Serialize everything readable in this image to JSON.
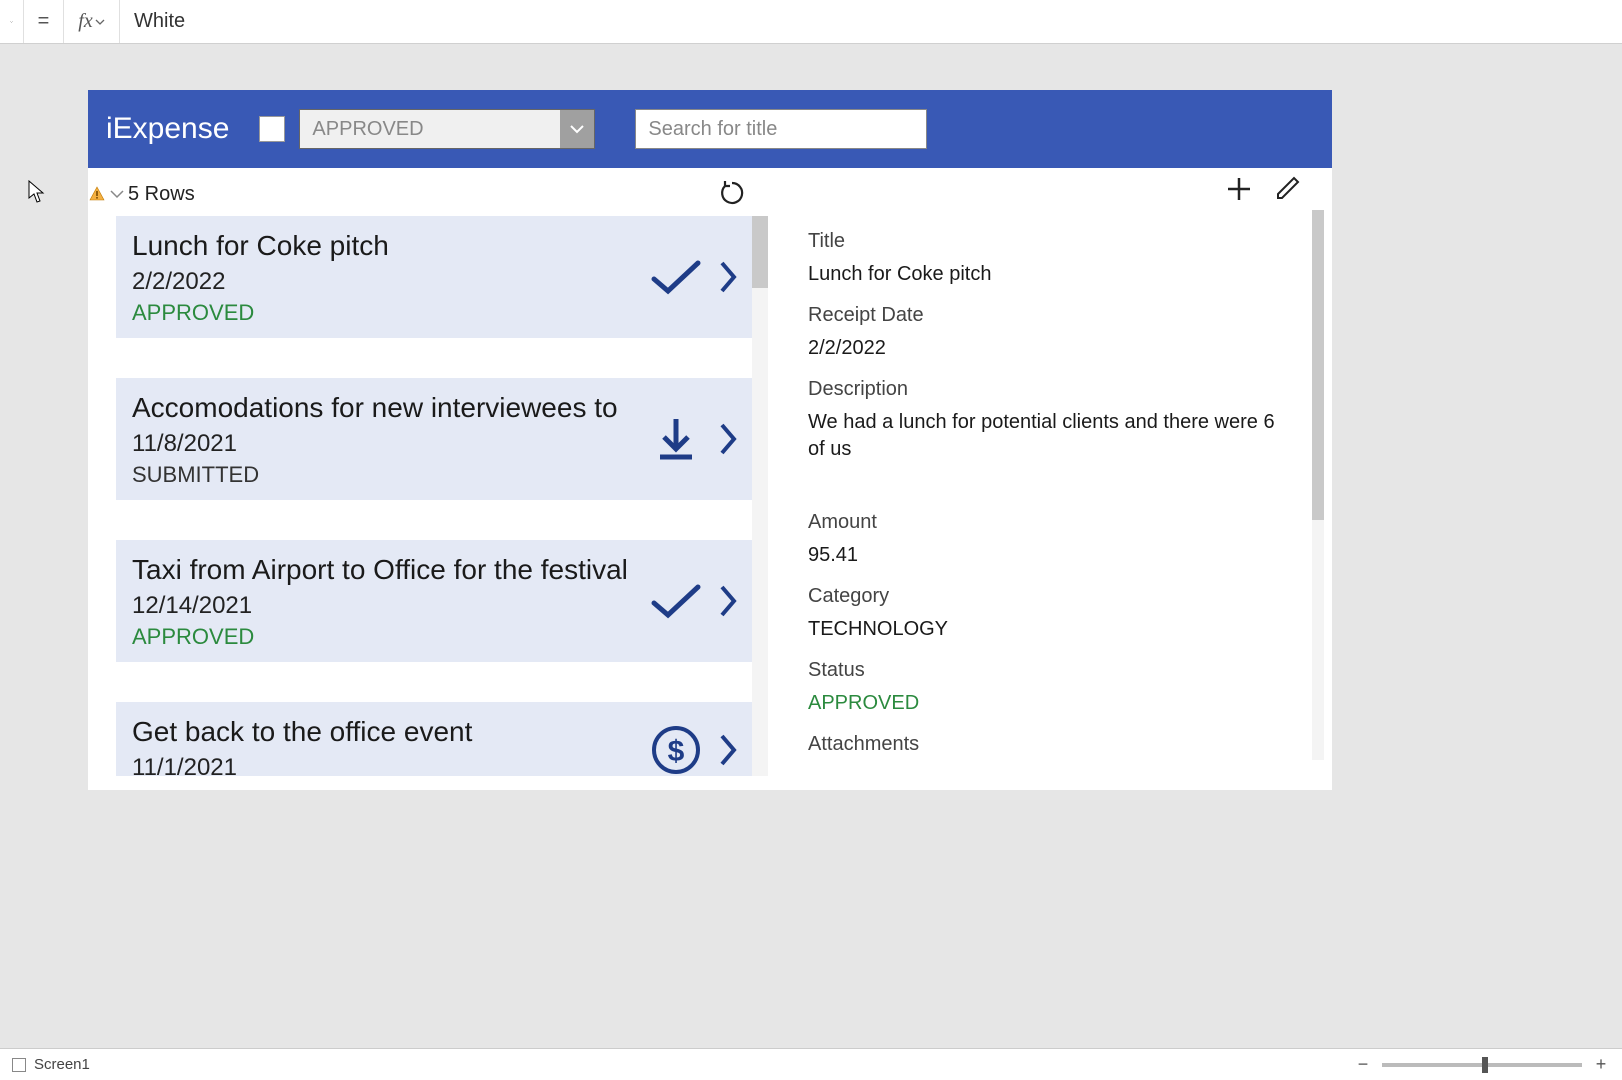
{
  "formula_bar": {
    "value": "White"
  },
  "app": {
    "title": "iExpense",
    "status_filter": "APPROVED",
    "search_placeholder": "Search for title"
  },
  "rows_count": "5 Rows",
  "gallery": [
    {
      "title": "Lunch for Coke pitch",
      "date": "2/2/2022",
      "status": "APPROVED",
      "icon": "check"
    },
    {
      "title": "Accomodations for new interviewees to",
      "date": "11/8/2021",
      "status": "SUBMITTED",
      "icon": "download"
    },
    {
      "title": "Taxi from Airport to Office for the festival",
      "date": "12/14/2021",
      "status": "APPROVED",
      "icon": "check"
    },
    {
      "title": "Get back to the office event",
      "date": "11/1/2021",
      "status": "",
      "icon": "dollar"
    }
  ],
  "detail": {
    "labels": {
      "title": "Title",
      "receipt_date": "Receipt Date",
      "description": "Description",
      "amount": "Amount",
      "category": "Category",
      "status": "Status",
      "attachments": "Attachments"
    },
    "values": {
      "title": "Lunch for Coke pitch",
      "receipt_date": "2/2/2022",
      "description": "We had a lunch for potential clients and there were 6 of us",
      "amount": "95.41",
      "category": "TECHNOLOGY",
      "status": "APPROVED"
    }
  },
  "footer": {
    "screen_name": "Screen1"
  }
}
